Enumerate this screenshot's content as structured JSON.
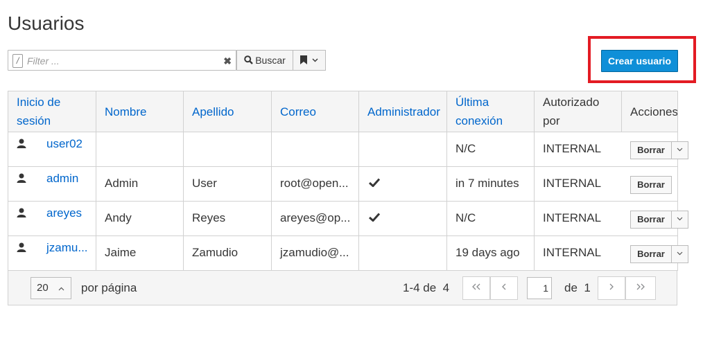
{
  "page": {
    "title": "Usuarios"
  },
  "toolbar": {
    "filter_placeholder": "Filter ...",
    "filter_value": "",
    "slash_glyph": "/",
    "search_label": "Buscar",
    "create_label": "Crear usuario"
  },
  "table": {
    "headers": [
      {
        "l1": "Inicio de",
        "l2": "sesión"
      },
      {
        "l1": "Nombre",
        "l2": ""
      },
      {
        "l1": "Apellido",
        "l2": ""
      },
      {
        "l1": "Correo",
        "l2": ""
      },
      {
        "l1": "Administrador",
        "l2": ""
      },
      {
        "l1": "Última",
        "l2": "conexión"
      },
      {
        "l1": "Autorizado",
        "l2": "por"
      },
      {
        "l1": "Acciones",
        "l2": ""
      }
    ],
    "rows": [
      {
        "login": "user02",
        "first": "",
        "last": "",
        "email": "",
        "admin": false,
        "last_login": "N/C",
        "auth": "INTERNAL",
        "action": "Borrar",
        "dropdown": true
      },
      {
        "login": "admin",
        "first": "Admin",
        "last": "User",
        "email": "root@open...",
        "admin": true,
        "last_login": "in 7 minutes",
        "auth": "INTERNAL",
        "action": "Borrar",
        "dropdown": false
      },
      {
        "login": "areyes",
        "first": "Andy",
        "last": "Reyes",
        "email": "areyes@op...",
        "admin": true,
        "last_login": "N/C",
        "auth": "INTERNAL",
        "action": "Borrar",
        "dropdown": true
      },
      {
        "login": "jzamu...",
        "first": "Jaime",
        "last": "Zamudio",
        "email": "jzamudio@...",
        "admin": false,
        "last_login": "19 days ago",
        "auth": "INTERNAL",
        "action": "Borrar",
        "dropdown": true
      }
    ]
  },
  "pagination": {
    "per_page": "20",
    "per_page_label": "por página",
    "range_label": "1-4 de",
    "total": "4",
    "current_page": "1",
    "of_label": "de",
    "total_pages": "1"
  },
  "colors": {
    "accent": "#0066cc",
    "primary_button": "#0f8fd8",
    "highlight": "#e31b23"
  }
}
